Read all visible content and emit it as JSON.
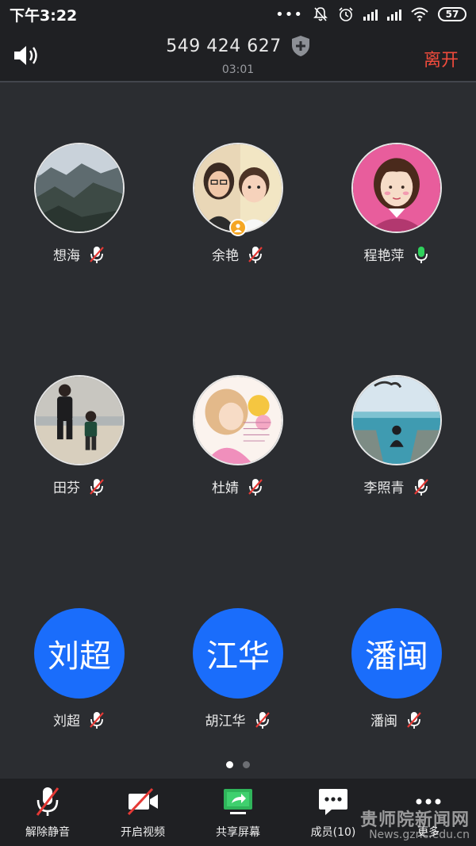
{
  "status": {
    "time": "下午3:22",
    "battery": "57"
  },
  "header": {
    "meeting_id": "549 424 627",
    "duration": "03:01",
    "leave_label": "离开"
  },
  "participants": [
    {
      "name": "想海",
      "mic": "muted",
      "avatar_type": "photo-landscape"
    },
    {
      "name": "余艳",
      "mic": "muted",
      "avatar_type": "photo-family",
      "host": true
    },
    {
      "name": "程艳萍",
      "mic": "active",
      "avatar_type": "cartoon-woman"
    },
    {
      "name": "田芬",
      "mic": "muted",
      "avatar_type": "photo-beach"
    },
    {
      "name": "杜婧",
      "mic": "muted",
      "avatar_type": "illustration-pink"
    },
    {
      "name": "李照青",
      "mic": "muted",
      "avatar_type": "photo-sea"
    },
    {
      "name": "刘超",
      "mic": "muted",
      "avatar_text": "刘超"
    },
    {
      "name": "胡江华",
      "mic": "muted",
      "avatar_text": "江华"
    },
    {
      "name": "潘闽",
      "mic": "muted",
      "avatar_text": "潘闽"
    }
  ],
  "pagination": {
    "current": 1,
    "total": 2
  },
  "toolbar": {
    "unmute_label": "解除静音",
    "video_label": "开启视频",
    "share_label": "共享屏幕",
    "members_label": "成员(10)",
    "more_label": "更多"
  },
  "watermark": {
    "cn": "贵师院新闻网",
    "url": "News.gznc.edu.cn"
  },
  "colors": {
    "background": "#2b2d31",
    "bar": "#1f2023",
    "avatar_blue": "#1a6dfb",
    "leave_red": "#f04b3c",
    "mic_green": "#2fd15c",
    "mute_red": "#e53935"
  }
}
